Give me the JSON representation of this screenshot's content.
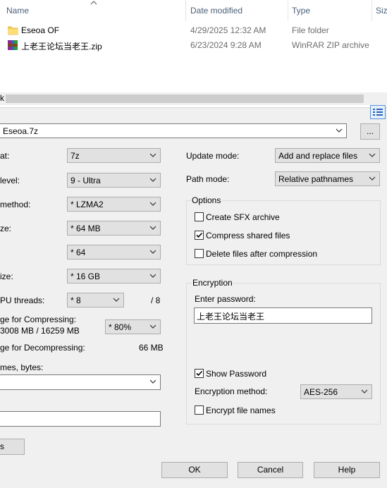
{
  "explorer": {
    "headers": {
      "name": "Name",
      "date": "Date modified",
      "type": "Type",
      "size": "Siz"
    },
    "files": [
      {
        "name": "Eseoa OF",
        "date": "4/29/2025 12:32 AM",
        "type": "File folder",
        "icon": "folder-icon"
      },
      {
        "name": "上老王论坛当老王.zip",
        "date": "6/23/2024 9:28 AM",
        "type": "WinRAR ZIP archive",
        "icon": "winrar-archive-icon"
      }
    ],
    "left_edge_text": "k"
  },
  "dialog": {
    "archive_path": "Eseoa.7z",
    "browse_label": "...",
    "left": {
      "format_label": "at:",
      "format_value": "7z",
      "level_label": " level:",
      "level_value": "9 - Ultra",
      "method_label": " method:",
      "method_value": "*  LZMA2",
      "dict_label": "ze:",
      "dict_value": "*  64 MB",
      "word_value": "*  64",
      "solid_label": "ize:",
      "solid_value": "*  16 GB",
      "threads_label": "PU threads:",
      "threads_value": "*  8",
      "threads_max": "/ 8",
      "mem_comp_label": "ge for Compressing:",
      "mem_comp_value": "3008 MB / 16259 MB",
      "mem_pct": "*  80%",
      "mem_decomp_label": "ge for Decompressing:",
      "mem_decomp_value": "66 MB",
      "split_label": "mes, bytes:",
      "params_button": "s"
    },
    "right": {
      "update_label": "Update mode:",
      "update_value": "Add and replace files",
      "path_label": "Path mode:",
      "path_value": "Relative pathnames",
      "options_title": "Options",
      "opt_sfx": "Create SFX archive",
      "opt_sfx_checked": false,
      "opt_shared": "Compress shared files",
      "opt_shared_checked": true,
      "opt_delete": "Delete files after compression",
      "opt_delete_checked": false,
      "enc_title": "Encryption",
      "enter_password_label": "Enter password:",
      "password_value": "上老王论坛当老王",
      "show_password": "Show Password",
      "show_password_checked": true,
      "enc_method_label": "Encryption method:",
      "enc_method_value": "AES-256",
      "encrypt_names": "Encrypt file names",
      "encrypt_names_checked": false
    },
    "buttons": {
      "ok": "OK",
      "cancel": "Cancel",
      "help": "Help"
    }
  }
}
